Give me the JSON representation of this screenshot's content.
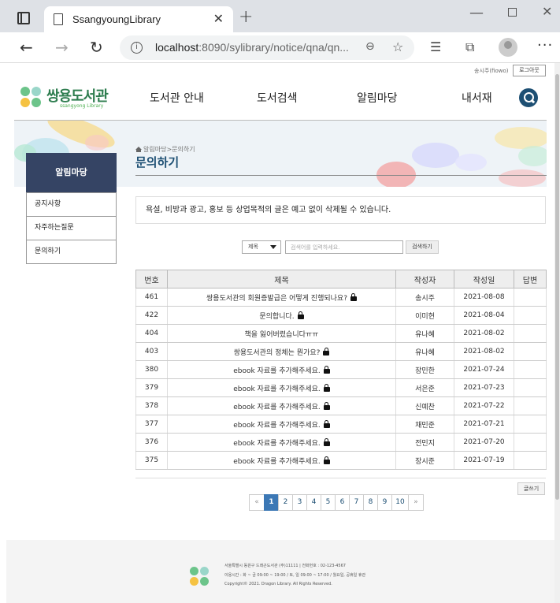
{
  "browser": {
    "tab_title": "SsangyoungLibrary",
    "url_host": "localhost",
    "url_rest": ":8090/sylibrary/notice/qna/qn...",
    "icons": [
      "sidebar-icon",
      "page-icon",
      "close-icon",
      "plus-icon",
      "minimize-icon",
      "maximize-icon",
      "close-window-icon",
      "back-icon",
      "forward-icon",
      "reload-icon",
      "info-icon",
      "zoom-icon",
      "favorite-add-icon",
      "favorites-icon",
      "collections-icon",
      "profile-icon",
      "more-icon"
    ]
  },
  "header": {
    "user_label": "송시주(fiowo)",
    "logout_label": "로그아웃",
    "logo_title": "쌍용도서관",
    "logo_subtitle": "ssangyong Library",
    "nav": [
      "도서관 안내",
      "도서검색",
      "알림마당",
      "내서재"
    ],
    "colors": {
      "brand_green": "#2e7d4f",
      "nav_navy": "#1d4f73",
      "side_head": "#354464",
      "pager_active": "#3c78b5"
    }
  },
  "sidebar": {
    "heading": "알림마당",
    "items": [
      "공지사항",
      "자주하는질문",
      "문의하기"
    ]
  },
  "content": {
    "breadcrumb": "알림마당>문의하기",
    "title": "문의하기",
    "notice": "욕설, 비방과 광고, 홍보 등 상업목적의 글은 예고 없이 삭제될 수 있습니다."
  },
  "search": {
    "select_value": "제목",
    "placeholder": "검색어를 입력하세요.",
    "button_label": "검색하기"
  },
  "board": {
    "columns": [
      "번호",
      "제목",
      "작성자",
      "작성일",
      "답변"
    ],
    "rows": [
      {
        "no": "461",
        "title": "쌍용도서관의 회원증발급은 어떻게 진행되나요?",
        "author": "송시주",
        "date": "2021-08-08",
        "answer": "",
        "locked": true
      },
      {
        "no": "422",
        "title": "문의합니다.",
        "author": "이미현",
        "date": "2021-08-04",
        "answer": "",
        "locked": true
      },
      {
        "no": "404",
        "title": "책을 잃어버렸습니다ㅠㅠ",
        "author": "유나혜",
        "date": "2021-08-02",
        "answer": "",
        "locked": false
      },
      {
        "no": "403",
        "title": "쌍용도서관의 정체는 뭔가요?",
        "author": "유나혜",
        "date": "2021-08-02",
        "answer": "",
        "locked": true
      },
      {
        "no": "380",
        "title": "ebook 자료를 추가해주세요.",
        "author": "장민한",
        "date": "2021-07-24",
        "answer": "",
        "locked": true
      },
      {
        "no": "379",
        "title": "ebook 자료를 추가해주세요.",
        "author": "서은준",
        "date": "2021-07-23",
        "answer": "",
        "locked": true
      },
      {
        "no": "378",
        "title": "ebook 자료를 추가해주세요.",
        "author": "신예찬",
        "date": "2021-07-22",
        "answer": "",
        "locked": true
      },
      {
        "no": "377",
        "title": "ebook 자료를 추가해주세요.",
        "author": "채민준",
        "date": "2021-07-21",
        "answer": "",
        "locked": true
      },
      {
        "no": "376",
        "title": "ebook 자료를 추가해주세요.",
        "author": "전민지",
        "date": "2021-07-20",
        "answer": "",
        "locked": true
      },
      {
        "no": "375",
        "title": "ebook 자료를 추가해주세요.",
        "author": "장시준",
        "date": "2021-07-19",
        "answer": "",
        "locked": true
      }
    ],
    "write_label": "글쓰기"
  },
  "pager": {
    "first": "«",
    "pages": [
      "1",
      "2",
      "3",
      "4",
      "5",
      "6",
      "7",
      "8",
      "9",
      "10"
    ],
    "active": "1",
    "last": "»"
  },
  "footer": {
    "line1": "서울특별시 동원구 드래곤도서관 (주)11111 | 전화번호 : 02-123-4567",
    "line2": "이용시간 : 화 ~ 금 09:00 ~ 19:00 / 토, 일 09:00 ~ 17:00 / 월요일, 공휴일 휴관",
    "line3": "Copyright© 2021. Dragon Library. All Rights Reserved."
  }
}
